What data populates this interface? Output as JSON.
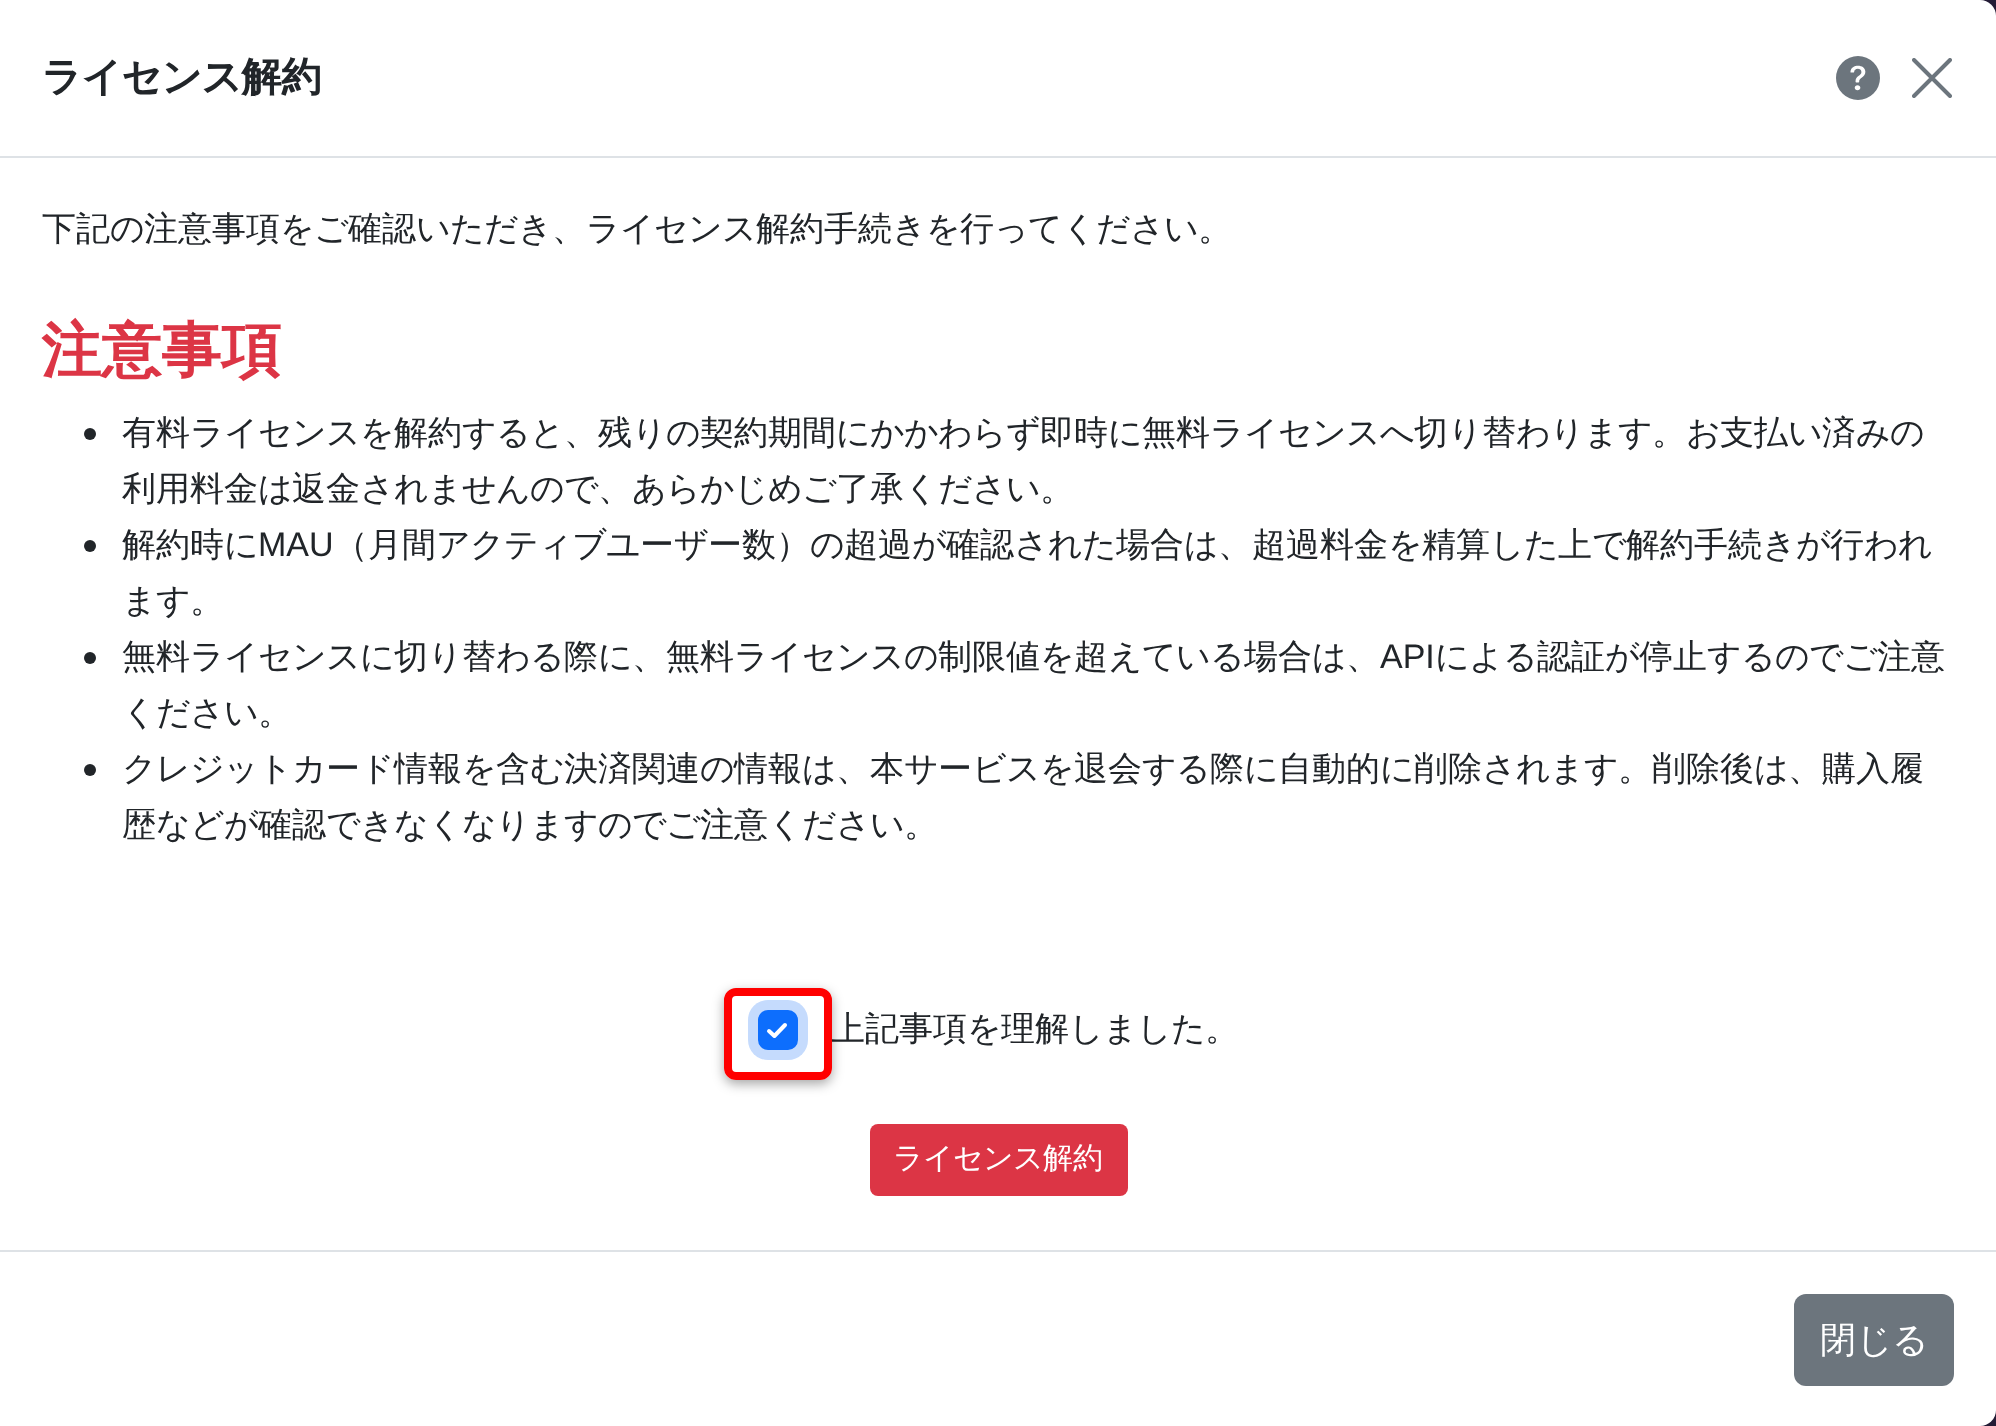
{
  "dialog": {
    "title": "ライセンス解約"
  },
  "intro": "下記の注意事項をご確認いただき、ライセンス解約手続きを行ってください。",
  "notice": {
    "heading": "注意事項",
    "items": [
      "有料ライセンスを解約すると、残りの契約期間にかかわらず即時に無料ライセンスへ切り替わります。お支払い済みの利用料金は返金されませんので、あらかじめご了承ください。",
      "解約時にMAU（月間アクティブユーザー数）の超過が確認された場合は、超過料金を精算した上で解約手続きが行われます。",
      "無料ライセンスに切り替わる際に、無料ライセンスの制限値を超えている場合は、APIによる認証が停止するのでご注意ください。",
      "クレジットカード情報を含む決済関連の情報は、本サービスを退会する際に自動的に削除されます。削除後は、購入履歴などが確認できなくなりますのでご注意ください。"
    ]
  },
  "agreement": {
    "label": "上記事項を理解しました。",
    "checked": true,
    "highlighted": true
  },
  "cancel_license_button": {
    "label": "ライセンス解約"
  },
  "footer": {
    "close_button": {
      "label": "閉じる"
    }
  }
}
